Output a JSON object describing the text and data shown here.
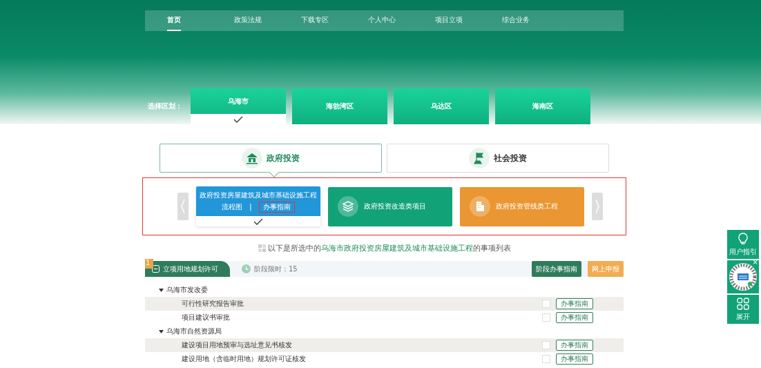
{
  "nav": [
    {
      "label": "首页",
      "selected": true
    },
    {
      "label": "政策法规",
      "selected": false
    },
    {
      "label": "下载专区",
      "selected": false
    },
    {
      "label": "个人中心",
      "selected": false
    },
    {
      "label": "项目立项",
      "selected": false
    },
    {
      "label": "综合业务",
      "selected": false
    }
  ],
  "region": {
    "label": "选择区划：",
    "items": [
      {
        "label": "乌海市",
        "selected": true
      },
      {
        "label": "海勃湾区",
        "selected": false
      },
      {
        "label": "乌达区",
        "selected": false
      },
      {
        "label": "海南区",
        "selected": false
      }
    ]
  },
  "investment_tabs": [
    {
      "label": "政府投资",
      "selected": true,
      "kind": "government"
    },
    {
      "label": "社会投资",
      "selected": false,
      "kind": "social"
    }
  ],
  "project_cards": [
    {
      "title": "政府投资房屋建筑及城市基础设施工程",
      "selected": true,
      "color": "#2196d9",
      "links": [
        "流程图",
        "|",
        "办事指南"
      ]
    },
    {
      "title": "政府投资改造类项目",
      "selected": false,
      "kind": "renovation",
      "color": "#12a278"
    },
    {
      "title": "政府投资管线类工程",
      "selected": false,
      "kind": "pipeline",
      "color": "#ea9632"
    }
  ],
  "list_title": {
    "prefix": "以下是所选中的",
    "highlight": "乌海市政府投资房屋建筑及城市基础设施工程",
    "suffix": "的事项列表"
  },
  "stage": {
    "number": "1",
    "name": "立项用地规划许可",
    "expanded": true,
    "time_limit": "阶段限时：15",
    "buttons": [
      "阶段办事指南",
      "网上申报"
    ]
  },
  "departments": [
    {
      "name": "乌海市发改委",
      "expanded": true,
      "items": [
        {
          "name": "可行性研究报告审批",
          "checked": false,
          "button": "办事指南"
        },
        {
          "name": "项目建议书审批",
          "checked": false,
          "button": "办事指南"
        }
      ]
    },
    {
      "name": "乌海市自然资源局",
      "expanded": true,
      "items": [
        {
          "name": "建设项目用地预审与选址意见书核发",
          "checked": false,
          "button": "办事指南"
        },
        {
          "name": "建设用地（含临时用地）规划许可证核发",
          "checked": false,
          "button": "办事指南"
        }
      ]
    }
  ],
  "side_tools": [
    {
      "kind": "guide",
      "label": "用户指引"
    },
    {
      "kind": "qr",
      "close": "×"
    },
    {
      "kind": "expand",
      "label": "展开"
    }
  ]
}
